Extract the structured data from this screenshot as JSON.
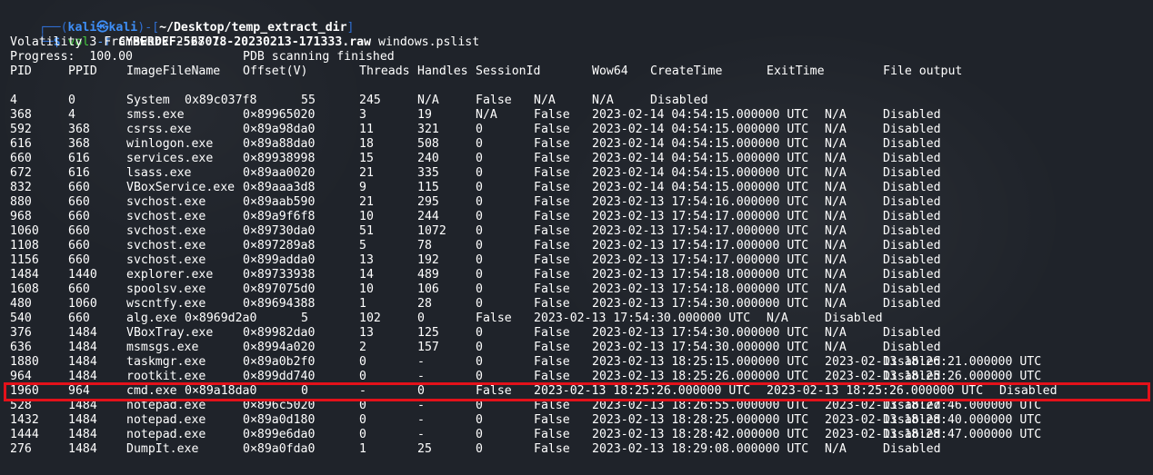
{
  "prompt": {
    "user": "kali",
    "at_symbol": "㉿",
    "host": "kali",
    "path": "~/Desktop/temp_extract_dir",
    "command": "vol",
    "flag": "-f",
    "file": "CYBERDEF-567078-20230213-171333.raw",
    "plugin": "windows.pslist"
  },
  "output": {
    "framework": "Volatility 3 Framework 2.28.1",
    "progress": "Progress:  100.00",
    "progress_status": "PDB scanning finished",
    "headers": [
      "PID",
      "PPID",
      "ImageFileName",
      "Offset(V)",
      "Threads",
      "Handles",
      "SessionId",
      "Wow64",
      "CreateTime",
      "ExitTime",
      "File output"
    ]
  },
  "rows": [
    {
      "pid": "4",
      "ppid": "0",
      "name": "System",
      "offset": "0x89c037f8",
      "threads": "55",
      "handles": "245",
      "session": "N/A",
      "wow64": "False",
      "create": "N/A",
      "exit": "N/A",
      "fileout": "Disabled",
      "layout": "b"
    },
    {
      "pid": "368",
      "ppid": "4",
      "name": "smss.exe",
      "offset": "0×89965020",
      "threads": "3",
      "handles": "19",
      "session": "N/A",
      "wow64": "False",
      "create": "2023-02-14 04:54:15.000000 UTC",
      "exit": "N/A",
      "fileout": "Disabled",
      "layout": "a"
    },
    {
      "pid": "592",
      "ppid": "368",
      "name": "csrss.exe",
      "offset": "0×89a98da0",
      "threads": "11",
      "handles": "321",
      "session": "0",
      "wow64": "False",
      "create": "2023-02-14 04:54:15.000000 UTC",
      "exit": "N/A",
      "fileout": "Disabled",
      "layout": "a"
    },
    {
      "pid": "616",
      "ppid": "368",
      "name": "winlogon.exe",
      "offset": "0×89a88da0",
      "threads": "18",
      "handles": "508",
      "session": "0",
      "wow64": "False",
      "create": "2023-02-14 04:54:15.000000 UTC",
      "exit": "N/A",
      "fileout": "Disabled",
      "layout": "a"
    },
    {
      "pid": "660",
      "ppid": "616",
      "name": "services.exe",
      "offset": "0×89938998",
      "threads": "15",
      "handles": "240",
      "session": "0",
      "wow64": "False",
      "create": "2023-02-14 04:54:15.000000 UTC",
      "exit": "N/A",
      "fileout": "Disabled",
      "layout": "a"
    },
    {
      "pid": "672",
      "ppid": "616",
      "name": "lsass.exe",
      "offset": "0×89aa0020",
      "threads": "21",
      "handles": "335",
      "session": "0",
      "wow64": "False",
      "create": "2023-02-14 04:54:15.000000 UTC",
      "exit": "N/A",
      "fileout": "Disabled",
      "layout": "a"
    },
    {
      "pid": "832",
      "ppid": "660",
      "name": "VBoxService.exe",
      "offset": "0×89aaa3d8",
      "threads": "9",
      "handles": "115",
      "session": "0",
      "wow64": "False",
      "create": "2023-02-14 04:54:15.000000 UTC",
      "exit": "N/A",
      "fileout": "Disabled",
      "layout": "a"
    },
    {
      "pid": "880",
      "ppid": "660",
      "name": "svchost.exe",
      "offset": "0×89aab590",
      "threads": "21",
      "handles": "295",
      "session": "0",
      "wow64": "False",
      "create": "2023-02-13 17:54:16.000000 UTC",
      "exit": "N/A",
      "fileout": "Disabled",
      "layout": "a"
    },
    {
      "pid": "968",
      "ppid": "660",
      "name": "svchost.exe",
      "offset": "0×89a9f6f8",
      "threads": "10",
      "handles": "244",
      "session": "0",
      "wow64": "False",
      "create": "2023-02-13 17:54:17.000000 UTC",
      "exit": "N/A",
      "fileout": "Disabled",
      "layout": "a"
    },
    {
      "pid": "1060",
      "ppid": "660",
      "name": "svchost.exe",
      "offset": "0×89730da0",
      "threads": "51",
      "handles": "1072",
      "session": "0",
      "wow64": "False",
      "create": "2023-02-13 17:54:17.000000 UTC",
      "exit": "N/A",
      "fileout": "Disabled",
      "layout": "a"
    },
    {
      "pid": "1108",
      "ppid": "660",
      "name": "svchost.exe",
      "offset": "0×897289a8",
      "threads": "5",
      "handles": "78",
      "session": "0",
      "wow64": "False",
      "create": "2023-02-13 17:54:17.000000 UTC",
      "exit": "N/A",
      "fileout": "Disabled",
      "layout": "a"
    },
    {
      "pid": "1156",
      "ppid": "660",
      "name": "svchost.exe",
      "offset": "0×899adda0",
      "threads": "13",
      "handles": "192",
      "session": "0",
      "wow64": "False",
      "create": "2023-02-13 17:54:17.000000 UTC",
      "exit": "N/A",
      "fileout": "Disabled",
      "layout": "a"
    },
    {
      "pid": "1484",
      "ppid": "1440",
      "name": "explorer.exe",
      "offset": "0×89733938",
      "threads": "14",
      "handles": "489",
      "session": "0",
      "wow64": "False",
      "create": "2023-02-13 17:54:18.000000 UTC",
      "exit": "N/A",
      "fileout": "Disabled",
      "layout": "a"
    },
    {
      "pid": "1608",
      "ppid": "660",
      "name": "spoolsv.exe",
      "offset": "0×897075d0",
      "threads": "10",
      "handles": "106",
      "session": "0",
      "wow64": "False",
      "create": "2023-02-13 17:54:18.000000 UTC",
      "exit": "N/A",
      "fileout": "Disabled",
      "layout": "a"
    },
    {
      "pid": "480",
      "ppid": "1060",
      "name": "wscntfy.exe",
      "offset": "0×89694388",
      "threads": "1",
      "handles": "28",
      "session": "0",
      "wow64": "False",
      "create": "2023-02-13 17:54:30.000000 UTC",
      "exit": "N/A",
      "fileout": "Disabled",
      "layout": "a"
    },
    {
      "pid": "540",
      "ppid": "660",
      "name": "alg.exe",
      "offset": "0×8969d2a0",
      "threads": "5",
      "handles": "102",
      "session": "0",
      "wow64": "False",
      "create": "2023-02-13 17:54:30.000000 UTC",
      "exit": "N/A",
      "fileout": "Disabled",
      "layout": "c"
    },
    {
      "pid": "376",
      "ppid": "1484",
      "name": "VBoxTray.exe",
      "offset": "0×89982da0",
      "threads": "13",
      "handles": "125",
      "session": "0",
      "wow64": "False",
      "create": "2023-02-13 17:54:30.000000 UTC",
      "exit": "N/A",
      "fileout": "Disabled",
      "layout": "a"
    },
    {
      "pid": "636",
      "ppid": "1484",
      "name": "msmsgs.exe",
      "offset": "0×8994a020",
      "threads": "2",
      "handles": "157",
      "session": "0",
      "wow64": "False",
      "create": "2023-02-13 17:54:30.000000 UTC",
      "exit": "N/A",
      "fileout": "Disabled",
      "layout": "a"
    },
    {
      "pid": "1880",
      "ppid": "1484",
      "name": "taskmgr.exe",
      "offset": "0×89a0b2f0",
      "threads": "0",
      "handles": "-",
      "session": "0",
      "wow64": "False",
      "create": "2023-02-13 18:25:15.000000 UTC",
      "exit": "2023-02-13 18:26:21.000000 UTC",
      "fileout": "Disabled",
      "layout": "a"
    },
    {
      "pid": "964",
      "ppid": "1484",
      "name": "rootkit.exe",
      "offset": "0×899dd740",
      "threads": "0",
      "handles": "-",
      "session": "0",
      "wow64": "False",
      "create": "2023-02-13 18:25:26.000000 UTC",
      "exit": "2023-02-13 18:25:26.000000 UTC",
      "fileout": "Disabled",
      "layout": "a"
    },
    {
      "pid": "1960",
      "ppid": "964",
      "name": "cmd.exe",
      "offset": "0×89a18da0",
      "threads": "0",
      "handles": "-",
      "session": "0",
      "wow64": "False",
      "create": "2023-02-13 18:25:26.000000 UTC",
      "exit": "2023-02-13 18:25:26.000000 UTC",
      "fileout": "Disabled",
      "layout": "d"
    },
    {
      "pid": "528",
      "ppid": "1484",
      "name": "notepad.exe",
      "offset": "0×896c5020",
      "threads": "0",
      "handles": "-",
      "session": "0",
      "wow64": "False",
      "create": "2023-02-13 18:26:55.000000 UTC",
      "exit": "2023-02-13 18:27:46.000000 UTC",
      "fileout": "Disabled",
      "layout": "a"
    },
    {
      "pid": "1432",
      "ppid": "1484",
      "name": "notepad.exe",
      "offset": "0×89a0d180",
      "threads": "0",
      "handles": "-",
      "session": "0",
      "wow64": "False",
      "create": "2023-02-13 18:28:25.000000 UTC",
      "exit": "2023-02-13 18:28:40.000000 UTC",
      "fileout": "Disabled",
      "layout": "a"
    },
    {
      "pid": "1444",
      "ppid": "1484",
      "name": "notepad.exe",
      "offset": "0×899e6da0",
      "threads": "0",
      "handles": "-",
      "session": "0",
      "wow64": "False",
      "create": "2023-02-13 18:28:42.000000 UTC",
      "exit": "2023-02-13 18:28:47.000000 UTC",
      "fileout": "Disabled",
      "layout": "a"
    },
    {
      "pid": "276",
      "ppid": "1484",
      "name": "DumpIt.exe",
      "offset": "0×89a0fda0",
      "threads": "1",
      "handles": "25",
      "session": "0",
      "wow64": "False",
      "create": "2023-02-13 18:29:08.000000 UTC",
      "exit": "N/A",
      "fileout": "Disabled",
      "layout": "a"
    }
  ],
  "highlight": {
    "pid": "1960",
    "color": "#e3111a"
  }
}
